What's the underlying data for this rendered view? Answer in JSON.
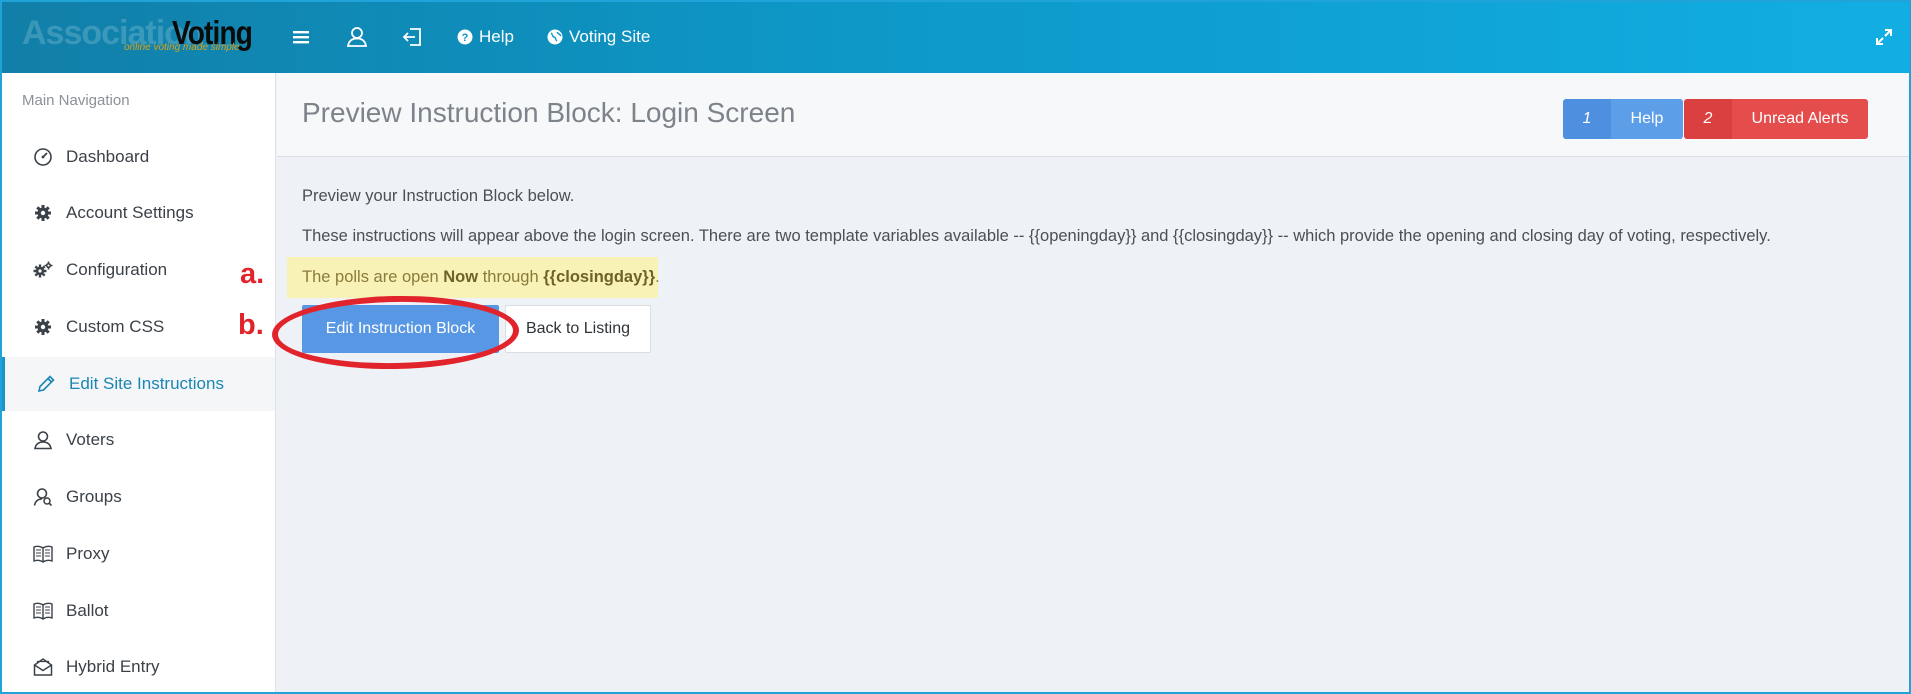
{
  "logo": {
    "word1": "Association",
    "word2": "Voting",
    "tagline": "online voting made simple"
  },
  "topnav": {
    "help_label": "Help",
    "voting_site_label": "Voting Site"
  },
  "sidebar": {
    "header": "Main Navigation",
    "items": [
      {
        "label": "Dashboard",
        "icon": "dashboard-icon"
      },
      {
        "label": "Account Settings",
        "icon": "gear-icon"
      },
      {
        "label": "Configuration",
        "icon": "gears-icon"
      },
      {
        "label": "Custom CSS",
        "icon": "gear-icon"
      },
      {
        "label": "Edit Site Instructions",
        "icon": "pencil-icon",
        "active": true
      },
      {
        "label": "Voters",
        "icon": "user-icon"
      },
      {
        "label": "Groups",
        "icon": "user-search-icon"
      },
      {
        "label": "Proxy",
        "icon": "book-icon"
      },
      {
        "label": "Ballot",
        "icon": "book-icon"
      },
      {
        "label": "Hybrid Entry",
        "icon": "envelope-open-icon"
      }
    ]
  },
  "page": {
    "title": "Preview Instruction Block: Login Screen",
    "help_count": "1",
    "help_label": "Help",
    "alerts_count": "2",
    "alerts_label": "Unread Alerts",
    "intro": "Preview your Instruction Block below.",
    "description": "These instructions will appear above the login screen. There are two template variables available -- {{openingday}} and {{closingday}} -- which provide the opening and closing day of voting, respectively.",
    "preview": {
      "prefix": "The polls are open ",
      "bold1": "Now",
      "middle": " through ",
      "bold2": "{{closingday}}",
      "suffix": "."
    },
    "edit_button": "Edit Instruction Block",
    "back_button": "Back to Listing"
  },
  "annotations": {
    "a": "a.",
    "b": "b."
  },
  "colors": {
    "accent": "#1b95c7",
    "annotation_red": "#e1232b",
    "primary_button": "#5797e3",
    "alert_red": "#e44d4b",
    "preview_highlight": "#f8f2b6"
  }
}
